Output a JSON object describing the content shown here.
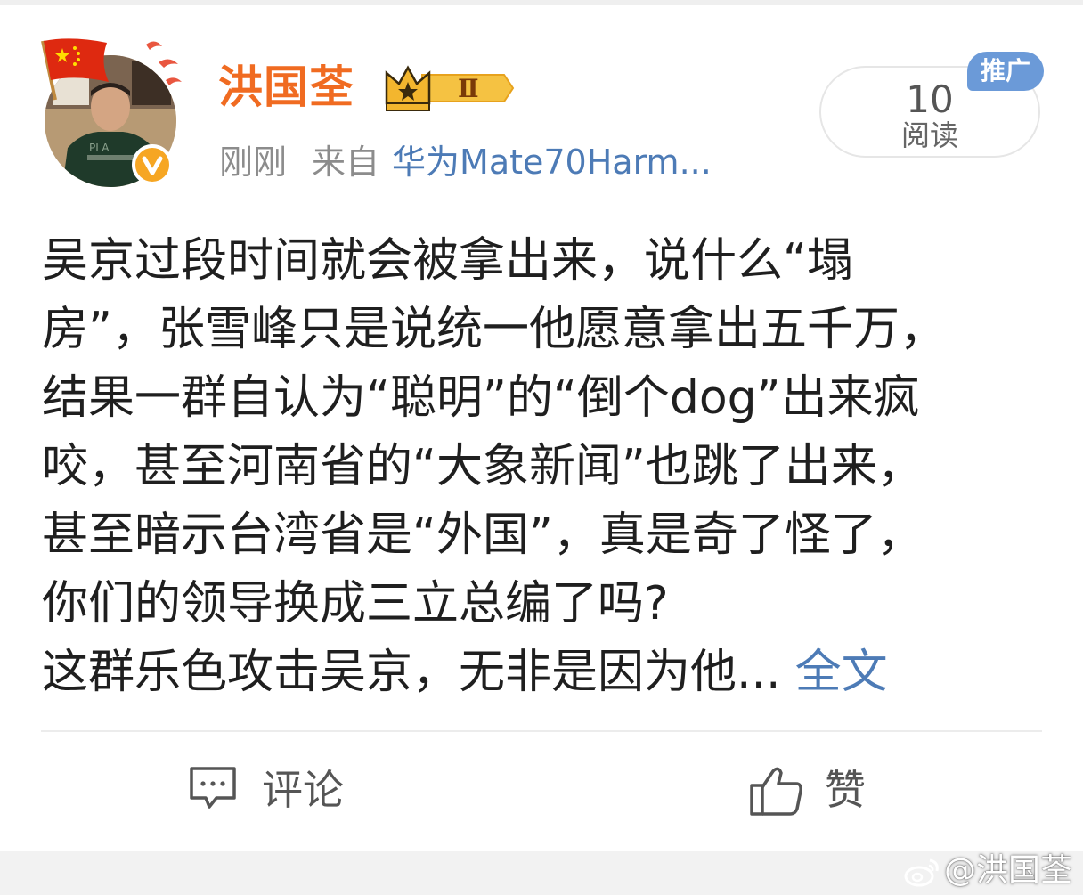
{
  "post": {
    "author": "洪国荃",
    "rank_badge": "Ⅱ",
    "time": "刚刚",
    "from_label": "来自",
    "source": "华为Mate70Harm...",
    "read_count": "10",
    "read_label": "阅读",
    "promo_tag": "推广",
    "content_lines": [
      "吴京过段时间就会被拿出来，说什么“塌",
      "房”，张雪峰只是说统一他愿意拿出五千万，",
      "结果一群自认为“聪明”的“倒个dog”出来疯",
      "咬，甚至河南省的“大象新闻”也跳了出来，",
      "甚至暗示台湾省是“外国”，真是奇了怪了，",
      "你们的领导换成三立总编了吗?",
      "这群乐色攻击吴京，无非是因为他..."
    ],
    "expand_label": "全文"
  },
  "actions": {
    "comment_label": "评论",
    "like_label": "赞"
  },
  "watermark": "@洪国荃",
  "icons": {
    "flag": "china-flag-icon",
    "verified": "verified-v-icon",
    "crown": "crown-badge-icon",
    "comment": "comment-icon",
    "like": "thumbs-up-icon",
    "weibo": "weibo-logo-icon"
  },
  "colors": {
    "author": "#f06b21",
    "link": "#4d7bb6",
    "promo": "#6b9ad8",
    "verified": "#f6a623"
  }
}
